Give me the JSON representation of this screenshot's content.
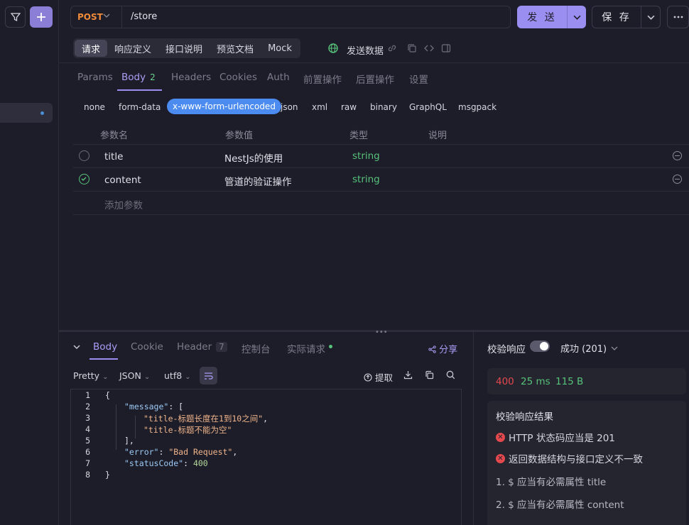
{
  "request": {
    "method": "POST",
    "url": "/store",
    "send_label": "发 送",
    "save_label": "保 存"
  },
  "subtabs": [
    "请求",
    "响应定义",
    "接口说明",
    "预览文档",
    "Mock"
  ],
  "send_data_label": "发送数据",
  "body_tabs": {
    "params": "Params",
    "body": "Body",
    "body_count": "2",
    "headers": "Headers",
    "cookies": "Cookies",
    "auth": "Auth",
    "pre": "前置操作",
    "post": "后置操作",
    "settings": "设置"
  },
  "body_types": [
    "none",
    "form-data",
    "x-www-form-urlencoded",
    "json",
    "xml",
    "raw",
    "binary",
    "GraphQL",
    "msgpack"
  ],
  "params_table": {
    "headers": [
      "参数名",
      "参数值",
      "类型",
      "说明"
    ],
    "rows": [
      {
        "name": "title",
        "value": "NestJs的使用",
        "type": "string",
        "checked": false
      },
      {
        "name": "content",
        "value": "管道的验证操作",
        "type": "string",
        "checked": true
      }
    ],
    "add_placeholder": "添加参数"
  },
  "response_tabs": {
    "body": "Body",
    "cookie": "Cookie",
    "header": "Header",
    "header_count": "7",
    "console": "控制台",
    "actual": "实际请求",
    "share": "分享"
  },
  "format": {
    "pretty": "Pretty",
    "json": "JSON",
    "encoding": "utf8",
    "extract": "提取"
  },
  "code_lines": [
    {
      "no": "1"
    },
    {
      "no": "2"
    },
    {
      "no": "3"
    },
    {
      "no": "4"
    },
    {
      "no": "5"
    },
    {
      "no": "6"
    },
    {
      "no": "7"
    },
    {
      "no": "8"
    }
  ],
  "code": {
    "open": "{",
    "message_key": "\"message\"",
    "message_open": ": [",
    "msg1": "\"title-标题长度在1到10之间\"",
    "msg1_comma": ",",
    "msg2": "\"title-标题不能为空\"",
    "message_close": "],",
    "error_key": "\"error\"",
    "error_colon": ": ",
    "error_val": "\"Bad Request\"",
    "error_comma": ",",
    "status_key": "\"statusCode\"",
    "status_colon": ": ",
    "status_val": "400",
    "close": "}"
  },
  "validation": {
    "label": "校验响应",
    "status": "成功 (201)",
    "status_code": "400",
    "time": "25 ms",
    "size": "115 B",
    "result_title": "校验响应结果",
    "errors": [
      "HTTP 状态码应当是 201",
      "返回数据结构与接口定义不一致"
    ],
    "missing": [
      "1. $ 应当有必需属性 title",
      "2. $ 应当有必需属性 content"
    ]
  },
  "colors": {
    "accent": "#9a8ff0",
    "post_method": "#f08b3a",
    "string_type": "#57c27a",
    "error_red": "#e5484d",
    "info_blue": "#4c8cf0"
  }
}
